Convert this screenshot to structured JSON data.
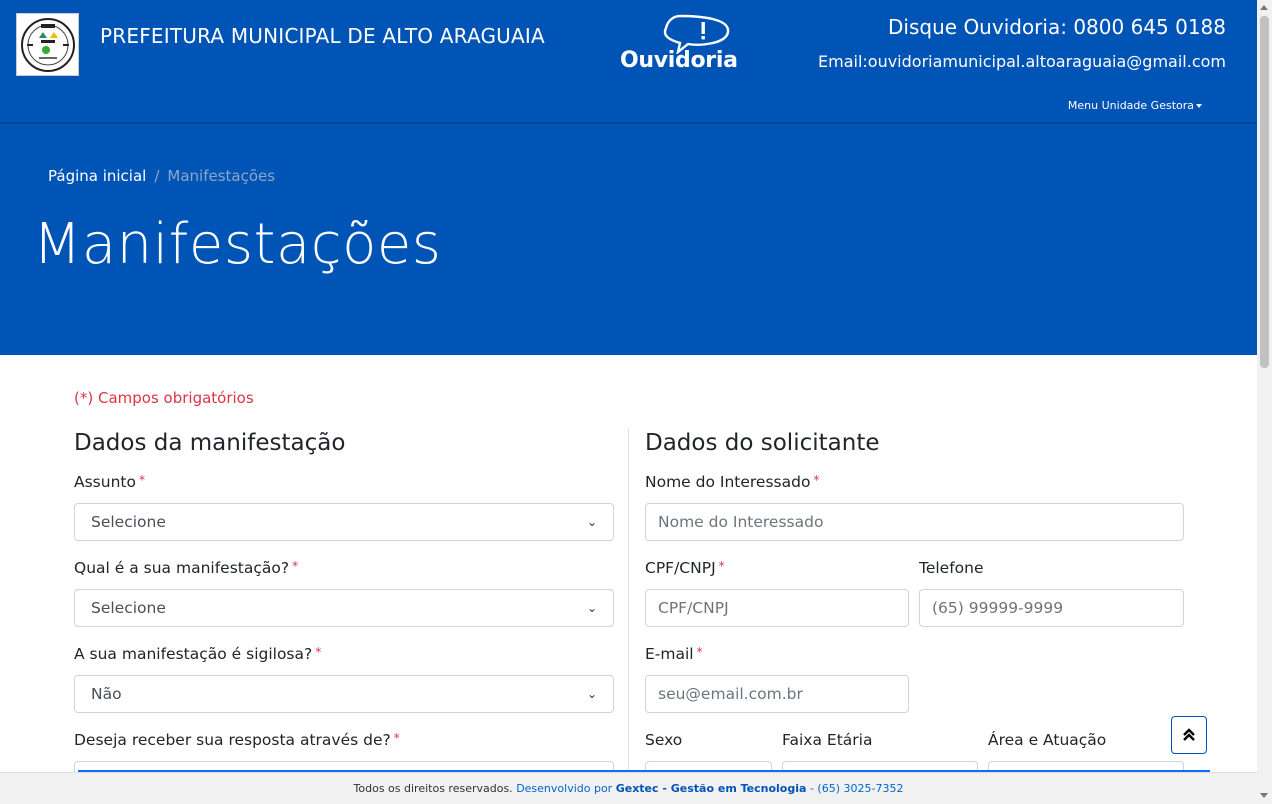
{
  "header": {
    "org_name": "PREFEITURA MUNICIPAL DE ALTO ARAGUAIA",
    "ouvidoria_brand": "Ouvidoria",
    "phone_text": "Disque Ouvidoria: 0800 645 0188",
    "email_text": "Email:ouvidoriamunicipal.altoaraguaia@gmail.com",
    "menu_label": "Menu Unidade Gestora"
  },
  "hero": {
    "breadcrumb_home": "Página inicial",
    "breadcrumb_separator": "/",
    "breadcrumb_current": "Manifestações",
    "title": "Manifestações"
  },
  "form": {
    "required_note": "(*) Campos obrigatórios",
    "required_mark": "*",
    "left": {
      "title": "Dados da manifestação",
      "assunto_label": "Assunto",
      "assunto_value": "Selecione",
      "manifestacao_label": "Qual é a sua manifestação?",
      "manifestacao_value": "Selecione",
      "sigilosa_label": "A sua manifestação é sigilosa?",
      "sigilosa_value": "Não",
      "resposta_label": "Deseja receber sua resposta através de?"
    },
    "right": {
      "title": "Dados do solicitante",
      "nome_label": "Nome do Interessado",
      "nome_placeholder": "Nome do Interessado",
      "cpf_label": "CPF/CNPJ",
      "cpf_placeholder": "CPF/CNPJ",
      "telefone_label": "Telefone",
      "telefone_placeholder": "(65) 99999-9999",
      "email_label": "E-mail",
      "email_placeholder": "seu@email.com.br",
      "sexo_label": "Sexo",
      "faixa_label": "Faixa Etária",
      "area_label": "Área e Atuação"
    }
  },
  "footer": {
    "rights": "Todos os direitos reservados.",
    "dev_prefix": "Desenvolvido por",
    "company": "Gextec - Gestão em Tecnologia",
    "dash": "-",
    "phone": "(65) 3025-7352"
  },
  "icons": {
    "back_to_top": "double-chevron-up-icon",
    "select_arrow": "chevron-down-icon"
  },
  "colors": {
    "header_bg": "#0054b6",
    "required": "#dc3545",
    "link": "#0066cc"
  }
}
